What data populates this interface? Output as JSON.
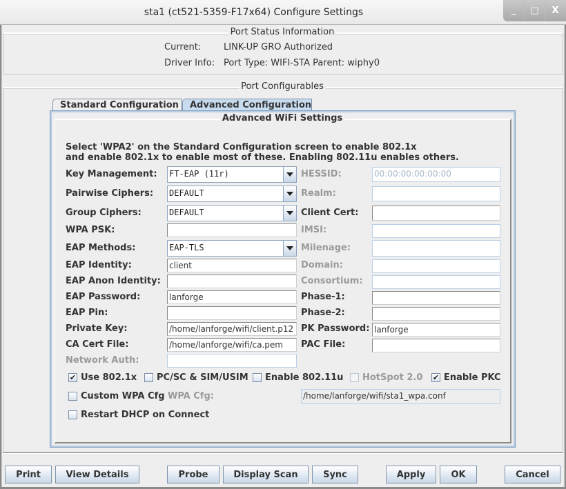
{
  "window": {
    "title": "sta1  (ct521-5359-F17x64) Configure Settings",
    "controls": {
      "minimize": "_",
      "maximize": "□",
      "close": "X"
    }
  },
  "status": {
    "section_title": "Port Status Information",
    "current_label": "Current:",
    "current_value": "LINK-UP GRO  Authorized",
    "driver_label": "Driver Info:",
    "driver_value": "Port Type: WIFI-STA   Parent: wiphy0"
  },
  "configurables": {
    "section_title": "Port Configurables",
    "tabs": [
      {
        "label": "Standard Configuration",
        "active": false
      },
      {
        "label": "Advanced Configuration",
        "active": true
      }
    ]
  },
  "advanced": {
    "section_title": "Advanced WiFi Settings",
    "note_line1": "Select 'WPA2' on the Standard Configuration screen to enable 802.1x",
    "note_line2": "and enable 802.1x to enable most of these. Enabling 802.11u enables others.",
    "left_fields": {
      "key_management": {
        "label": "Key Management:",
        "value": "FT-EAP (11r)"
      },
      "pairwise_ciphers": {
        "label": "Pairwise Ciphers:",
        "value": "DEFAULT"
      },
      "group_ciphers": {
        "label": "Group Ciphers:",
        "value": "DEFAULT"
      },
      "wpa_psk": {
        "label": "WPA PSK:",
        "value": ""
      },
      "eap_methods": {
        "label": "EAP Methods:",
        "value": "EAP-TLS"
      },
      "eap_identity": {
        "label": "EAP Identity:",
        "value": "client"
      },
      "eap_anon_identity": {
        "label": "EAP Anon Identity:",
        "value": ""
      },
      "eap_password": {
        "label": "EAP Password:",
        "value": "lanforge"
      },
      "eap_pin": {
        "label": "EAP Pin:",
        "value": ""
      },
      "private_key": {
        "label": "Private Key:",
        "value": "/home/lanforge/wifi/client.p12"
      },
      "ca_cert_file": {
        "label": "CA Cert File:",
        "value": "/home/lanforge/wifi/ca.pem"
      },
      "network_auth": {
        "label": "Network Auth:",
        "value": ""
      }
    },
    "right_fields": {
      "hessid": {
        "label": "HESSID:",
        "value": "",
        "placeholder": "00:00:00:00:00:00"
      },
      "realm": {
        "label": "Realm:",
        "value": ""
      },
      "client_cert": {
        "label": "Client Cert:",
        "value": ""
      },
      "imsi": {
        "label": "IMSI:",
        "value": ""
      },
      "milenage": {
        "label": "Milenage:",
        "value": ""
      },
      "domain": {
        "label": "Domain:",
        "value": ""
      },
      "consortium": {
        "label": "Consortium:",
        "value": ""
      },
      "phase1": {
        "label": "Phase-1:",
        "value": ""
      },
      "phase2": {
        "label": "Phase-2:",
        "value": ""
      },
      "pk_password": {
        "label": "PK Password:",
        "value": "lanforge"
      },
      "pac_file": {
        "label": "PAC File:",
        "value": ""
      }
    },
    "checkboxes": {
      "use_8021x": {
        "label": "Use 802.1x",
        "checked": true,
        "mark": "✔"
      },
      "pcsc_sim": {
        "label": "PC/SC & SIM/USIM",
        "checked": false,
        "mark": ""
      },
      "enable_80211u": {
        "label": "Enable 802.11u",
        "checked": false,
        "mark": ""
      },
      "hotspot20": {
        "label": "HotSpot 2.0",
        "checked": false,
        "mark": ""
      },
      "enable_pkc": {
        "label": "Enable PKC",
        "checked": true,
        "mark": "✔"
      },
      "custom_wpa_cfg": {
        "label": "Custom WPA Cfg",
        "checked": false,
        "mark": ""
      },
      "restart_dhcp": {
        "label": "Restart DHCP on Connect",
        "checked": false,
        "mark": ""
      }
    },
    "wpa_cfg": {
      "label": "WPA Cfg:",
      "value": "/home/lanforge/wifi/sta1_wpa.conf"
    }
  },
  "buttons": {
    "print": "Print",
    "view_details": "View Details",
    "probe": "Probe",
    "display_scan": "Display Scan",
    "sync": "Sync",
    "apply": "Apply",
    "ok": "OK",
    "cancel": "Cancel"
  }
}
